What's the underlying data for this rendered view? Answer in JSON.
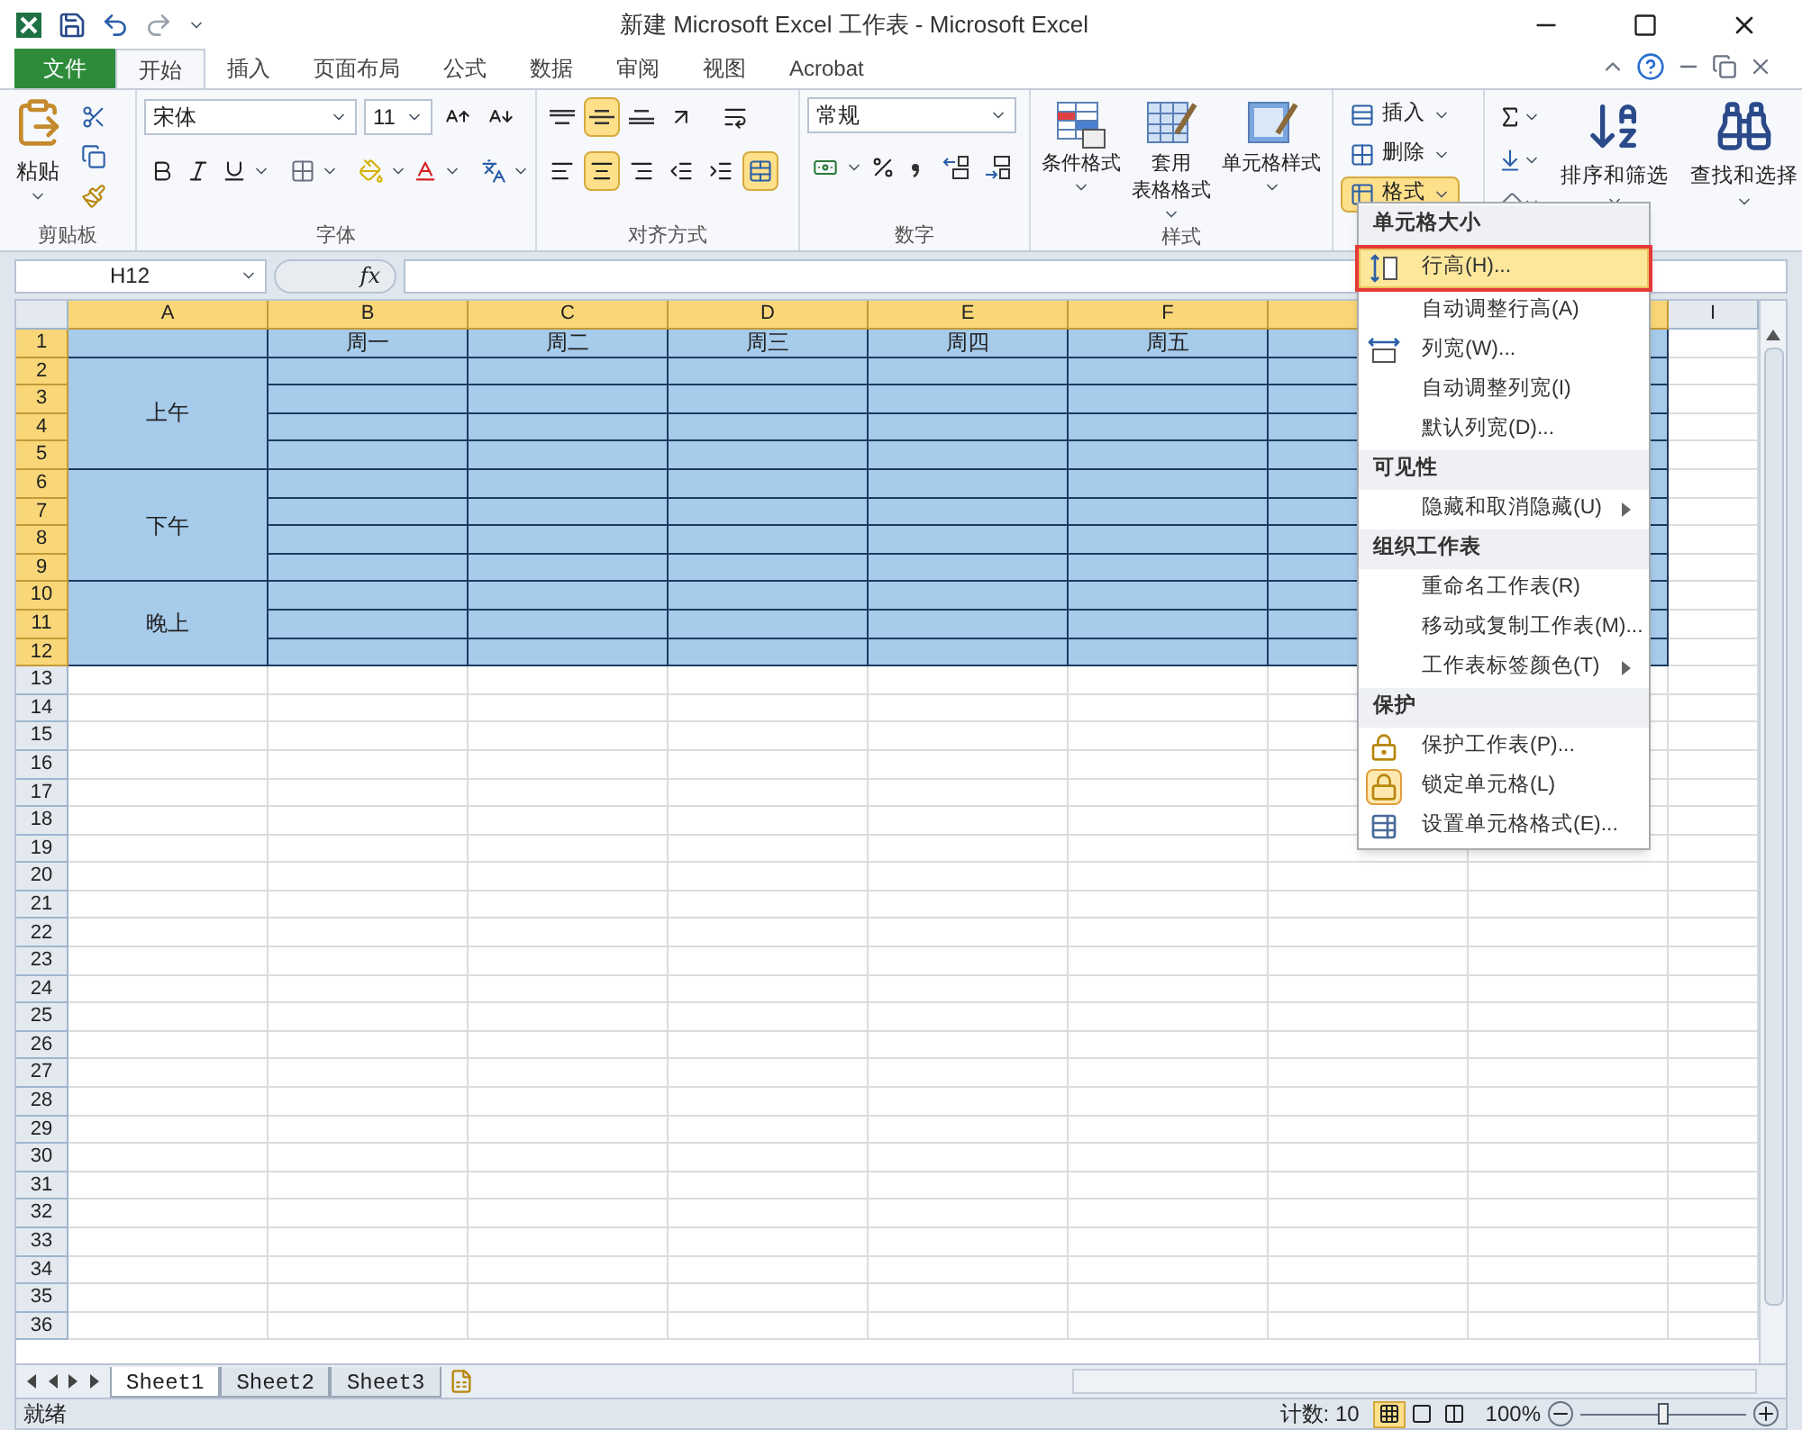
{
  "title_bar": {
    "title": "新建 Microsoft Excel 工作表 - Microsoft Excel"
  },
  "tabs": [
    {
      "label": "文件",
      "kind": "file",
      "selected": false
    },
    {
      "label": "开始",
      "kind": "tab",
      "selected": true
    },
    {
      "label": "插入",
      "kind": "tab",
      "selected": false
    },
    {
      "label": "页面布局",
      "kind": "tab",
      "selected": false
    },
    {
      "label": "公式",
      "kind": "tab",
      "selected": false
    },
    {
      "label": "数据",
      "kind": "tab",
      "selected": false
    },
    {
      "label": "审阅",
      "kind": "tab",
      "selected": false
    },
    {
      "label": "视图",
      "kind": "tab",
      "selected": false
    },
    {
      "label": "Acrobat",
      "kind": "tab",
      "selected": false
    }
  ],
  "ribbon": {
    "clipboard": {
      "label": "剪贴板",
      "paste": "粘贴"
    },
    "font": {
      "label": "字体",
      "font_name": "宋体",
      "font_size": "11"
    },
    "alignment": {
      "label": "对齐方式",
      "vertical": [
        {
          "kind": "top",
          "selected": false
        },
        {
          "kind": "middle",
          "selected": true
        },
        {
          "kind": "bottom",
          "selected": false
        }
      ],
      "horizontal": [
        {
          "kind": "left",
          "selected": false
        },
        {
          "kind": "center",
          "selected": true
        },
        {
          "kind": "right",
          "selected": false
        }
      ],
      "merge": {
        "selected": true
      }
    },
    "number": {
      "label": "数字",
      "format": "常规"
    },
    "styles": {
      "label": "样式",
      "buttons": [
        {
          "kind": "conditional",
          "lines": [
            "条件格式"
          ]
        },
        {
          "kind": "table",
          "lines": [
            "套用",
            "表格格式"
          ]
        },
        {
          "kind": "cell",
          "lines": [
            "单元格样式"
          ]
        }
      ]
    },
    "cells": [
      {
        "label": "插入",
        "kind": "insert",
        "active": false
      },
      {
        "label": "删除",
        "kind": "delete",
        "active": false
      },
      {
        "label": "格式",
        "kind": "format",
        "active": true
      }
    ],
    "editing": [
      {
        "label": "排序和筛选",
        "kind": "sort"
      },
      {
        "label": "查找和选择",
        "kind": "find"
      }
    ]
  },
  "formula_bar": {
    "name_box": "H12",
    "fx": "fx"
  },
  "sheet": {
    "columns": [
      {
        "label": "A",
        "selected": true
      },
      {
        "label": "B",
        "selected": true
      },
      {
        "label": "C",
        "selected": true
      },
      {
        "label": "D",
        "selected": true
      },
      {
        "label": "E",
        "selected": true
      },
      {
        "label": "F",
        "selected": true
      },
      {
        "selected": true
      },
      {
        "selected": true
      },
      {
        "label": "I",
        "selected": false
      }
    ],
    "rows": [
      {
        "label": "1",
        "selected": true
      },
      {
        "label": "2",
        "selected": true
      },
      {
        "label": "3",
        "selected": true
      },
      {
        "label": "4",
        "selected": true
      },
      {
        "label": "5",
        "selected": true
      },
      {
        "label": "6",
        "selected": true
      },
      {
        "label": "7",
        "selected": true
      },
      {
        "label": "8",
        "selected": true
      },
      {
        "label": "9",
        "selected": true
      },
      {
        "label": "10",
        "selected": true
      },
      {
        "label": "11",
        "selected": true
      },
      {
        "label": "12",
        "selected": true
      },
      {
        "label": "13",
        "selected": false
      },
      {
        "label": "14",
        "selected": false
      },
      {
        "label": "15",
        "selected": false
      },
      {
        "label": "16",
        "selected": false
      },
      {
        "label": "17",
        "selected": false
      },
      {
        "label": "18",
        "selected": false
      },
      {
        "label": "19",
        "selected": false
      },
      {
        "label": "20",
        "selected": false
      },
      {
        "label": "21",
        "selected": false
      },
      {
        "label": "22",
        "selected": false
      },
      {
        "label": "23",
        "selected": false
      },
      {
        "label": "24",
        "selected": false
      },
      {
        "label": "25",
        "selected": false
      },
      {
        "label": "26",
        "selected": false
      },
      {
        "label": "27",
        "selected": false
      },
      {
        "label": "28",
        "selected": false
      },
      {
        "label": "29",
        "selected": false
      },
      {
        "label": "30",
        "selected": false
      },
      {
        "label": "31",
        "selected": false
      },
      {
        "label": "32",
        "selected": false
      },
      {
        "label": "33",
        "selected": false
      },
      {
        "label": "34",
        "selected": false
      },
      {
        "label": "35",
        "selected": false
      },
      {
        "label": "36",
        "selected": false
      }
    ],
    "day_headers": [
      "周一",
      "周二",
      "周三",
      "周四",
      "周五"
    ],
    "blocks": [
      {
        "text": "上午"
      },
      {
        "text": "下午"
      },
      {
        "text": "晚上"
      }
    ]
  },
  "menu": {
    "sections": [
      {
        "title": "单元格大小",
        "items": [
          {
            "label": "行高(H)...",
            "kind": "row_height",
            "selected": true,
            "checked": false,
            "submenu": false
          },
          {
            "label": "自动调整行高(A)",
            "kind": "plain",
            "selected": false,
            "checked": false,
            "submenu": false
          },
          {
            "label": "列宽(W)...",
            "kind": "column_width",
            "selected": false,
            "checked": false,
            "submenu": false
          },
          {
            "label": "自动调整列宽(I)",
            "kind": "plain",
            "selected": false,
            "checked": false,
            "submenu": false
          },
          {
            "label": "默认列宽(D)...",
            "kind": "plain",
            "selected": false,
            "checked": false,
            "submenu": false
          }
        ]
      },
      {
        "title": "可见性",
        "items": [
          {
            "label": "隐藏和取消隐藏(U)",
            "kind": "plain",
            "selected": false,
            "checked": false,
            "submenu": true
          }
        ]
      },
      {
        "title": "组织工作表",
        "items": [
          {
            "label": "重命名工作表(R)",
            "kind": "plain",
            "selected": false,
            "checked": false,
            "submenu": false
          },
          {
            "label": "移动或复制工作表(M)...",
            "kind": "plain",
            "selected": false,
            "checked": false,
            "submenu": false
          },
          {
            "label": "工作表标签颜色(T)",
            "kind": "plain",
            "selected": false,
            "checked": false,
            "submenu": true
          }
        ]
      },
      {
        "title": "保护",
        "items": [
          {
            "label": "保护工作表(P)...",
            "kind": "protect",
            "selected": false,
            "checked": false,
            "submenu": false
          },
          {
            "label": "锁定单元格(L)",
            "kind": "lock",
            "selected": false,
            "checked": true,
            "submenu": false
          },
          {
            "label": "设置单元格格式(E)...",
            "kind": "format_cells",
            "selected": false,
            "checked": false,
            "submenu": false
          }
        ]
      }
    ]
  },
  "sheet_tabs": [
    {
      "label": "Sheet1",
      "selected": true
    },
    {
      "label": "Sheet2",
      "selected": false
    },
    {
      "label": "Sheet3",
      "selected": false
    }
  ],
  "status_bar": {
    "ready": "就绪",
    "count": "计数: 10",
    "views": [
      {
        "kind": "normal",
        "selected": true
      },
      {
        "kind": "layout",
        "selected": false
      },
      {
        "kind": "break",
        "selected": false
      }
    ],
    "zoom": "100%",
    "zoom_slider": {
      "level": 0.5
    }
  }
}
